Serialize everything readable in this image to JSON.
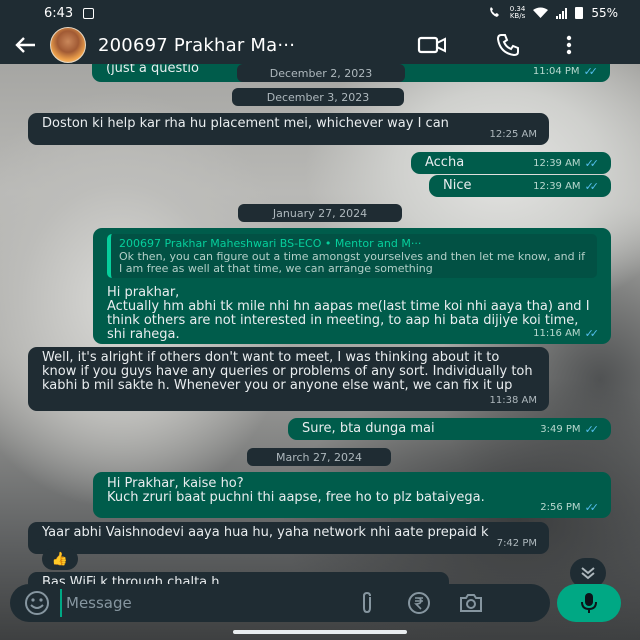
{
  "status_bar": {
    "time": "6:43",
    "net_speed": "0.34",
    "net_unit": "KB/s",
    "battery": "55%"
  },
  "header": {
    "contact_name": "200697 Prakhar Ma···"
  },
  "messages": [
    {
      "text": "(just a questio",
      "time": "11:04 PM",
      "dir": "out"
    },
    {
      "text": "Doston ki help kar rha hu placement mei, whichever way I can",
      "time": "12:25 AM",
      "dir": "in"
    },
    {
      "text": "Accha",
      "time": "12:39 AM",
      "dir": "out"
    },
    {
      "text": "Nice",
      "time": "12:39 AM",
      "dir": "out"
    },
    {
      "text": "Hi prakhar,\nActually hm abhi tk mile nhi hn aapas me(last time koi nhi aaya tha) and I think others are not interested in meeting, to aap hi bata dijiye koi time, shi rahega.",
      "time": "11:16 AM",
      "dir": "out"
    },
    {
      "text": "Well, it's alright if others don't want to meet, I was thinking about it to know if you guys have any queries or problems of any sort. Individually toh kabhi b mil sakte h. Whenever you or anyone else want, we can fix it up",
      "time": "11:38 AM",
      "dir": "in"
    },
    {
      "text": "Sure, bta dunga mai",
      "time": "3:49 PM",
      "dir": "out"
    },
    {
      "text": "Hi Prakhar, kaise ho?\nKuch zruri baat puchni thi aapse, free ho to plz bataiyega.",
      "time": "2:56 PM",
      "dir": "out"
    },
    {
      "text": "Yaar abhi Vaishnodevi aaya hua hu, yaha network nhi aate prepaid k",
      "time": "7:42 PM",
      "dir": "in"
    },
    {
      "text": "Bas WiFi k through chalta h",
      "time": "",
      "dir": "in"
    }
  ],
  "quote": {
    "author": "200697 Prakhar Maheshwari BS-ECO • Mentor and M···",
    "text": "Ok then, you can figure out a time amongst yourselves and then let me know, and if I am free as well at that time, we can arrange something"
  },
  "dates": [
    "December 2, 2023",
    "December 3, 2023",
    "January 27, 2024",
    "March 27, 2024"
  ],
  "reaction": "👍",
  "input": {
    "placeholder": "Message"
  },
  "colors": {
    "header_bg": "#1f2c33",
    "incoming_bubble": "#1f2c33",
    "outgoing_bubble": "#005c4b",
    "accent": "#00a884",
    "read_ticks": "#53bdeb"
  }
}
